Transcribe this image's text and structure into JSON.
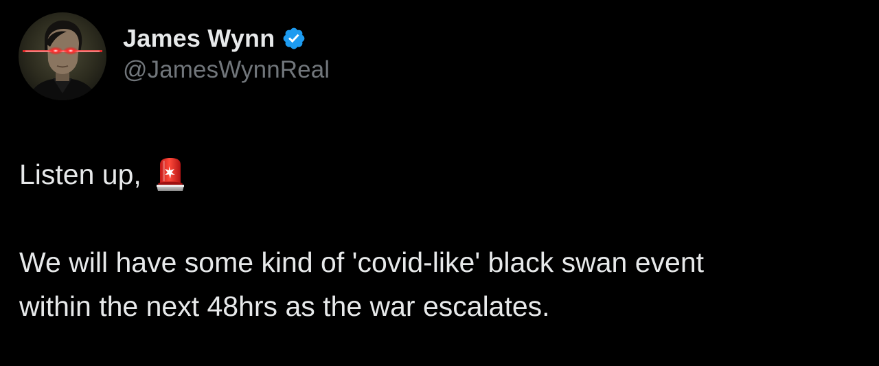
{
  "author": {
    "display_name": "James Wynn",
    "handle": "@JamesWynnReal",
    "verified": true,
    "avatar_icon": "avatar-laser-eyes",
    "verified_badge_icon": "verified-badge-icon"
  },
  "tweet": {
    "opening": "Listen up,",
    "opening_emoji": "police-siren-emoji",
    "paragraph_line_1": "We will have some kind of 'covid-like' black swan event",
    "paragraph_line_2": "within the next 48hrs as the war escalates."
  },
  "colors": {
    "background": "#000000",
    "text_primary": "#e7e9ea",
    "text_secondary": "#71767b",
    "verified_blue": "#1d9bf0",
    "laser_red": "#ff1a1a"
  }
}
